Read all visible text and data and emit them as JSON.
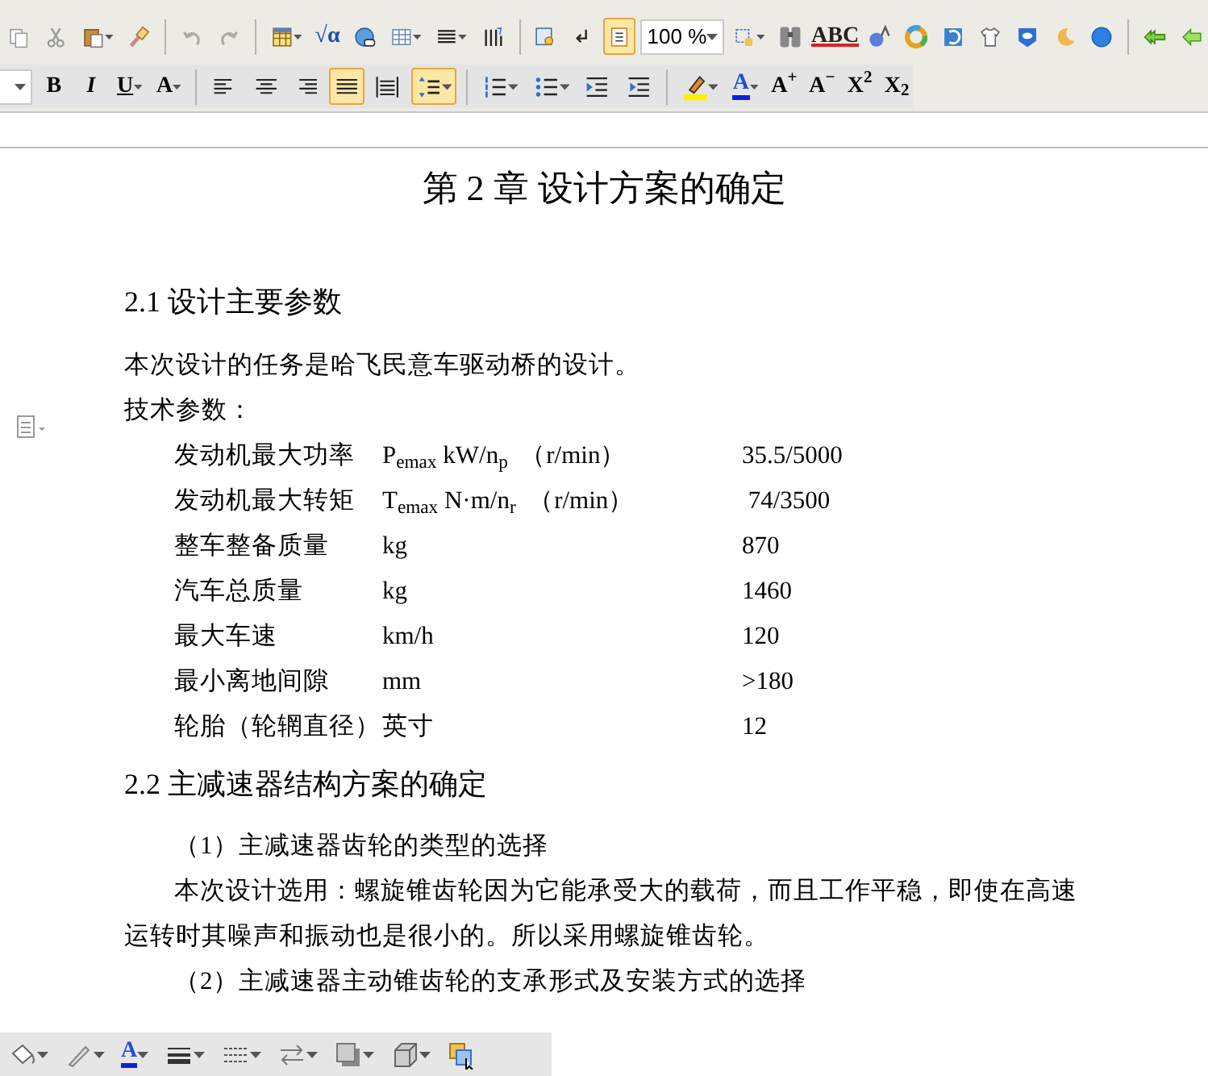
{
  "standard_toolbar": [
    {
      "kind": "button",
      "selected": false
    },
    {
      "kind": "button",
      "selected": false
    },
    {
      "kind": "button",
      "selected": false
    },
    {
      "kind": "button",
      "selected": false
    },
    {
      "kind": "button",
      "selected": false
    },
    {
      "kind": "button",
      "selected": false
    },
    {
      "kind": "button",
      "selected": false
    },
    {
      "kind": "button",
      "label": "√α",
      "selected": false
    },
    {
      "kind": "button",
      "selected": false
    },
    {
      "kind": "button",
      "selected": false
    },
    {
      "kind": "button",
      "selected": false
    },
    {
      "kind": "button",
      "selected": false
    },
    {
      "kind": "button",
      "selected": false
    },
    {
      "kind": "button",
      "selected": false
    },
    {
      "kind": "button",
      "selected": true
    },
    {
      "kind": "field",
      "value": "100 %"
    },
    {
      "kind": "button",
      "selected": false
    },
    {
      "kind": "button",
      "selected": false
    },
    {
      "kind": "button",
      "label": "ABC",
      "selected": false
    },
    {
      "kind": "button",
      "selected": false
    },
    {
      "kind": "button",
      "selected": false
    },
    {
      "kind": "button",
      "selected": false
    },
    {
      "kind": "button",
      "selected": false
    },
    {
      "kind": "button",
      "selected": false
    },
    {
      "kind": "button",
      "selected": false
    },
    {
      "kind": "button",
      "selected": false
    },
    {
      "kind": "button",
      "selected": false
    },
    {
      "kind": "button",
      "selected": false
    }
  ],
  "format_toolbar": [
    {
      "kind": "field"
    },
    {
      "kind": "button",
      "label": "B",
      "selected": false
    },
    {
      "kind": "button",
      "label": "I",
      "selected": false
    },
    {
      "kind": "button",
      "label": "U",
      "selected": false
    },
    {
      "kind": "button",
      "label": "A",
      "selected": false
    },
    {
      "kind": "button",
      "selected": false
    },
    {
      "kind": "button",
      "selected": false
    },
    {
      "kind": "button",
      "selected": false
    },
    {
      "kind": "button",
      "selected": true
    },
    {
      "kind": "button",
      "selected": false
    },
    {
      "kind": "button",
      "selected": true
    },
    {
      "kind": "button",
      "selected": false
    },
    {
      "kind": "button",
      "selected": false
    },
    {
      "kind": "button",
      "selected": false
    },
    {
      "kind": "button",
      "selected": false
    },
    {
      "kind": "button",
      "selected": false
    },
    {
      "kind": "button",
      "label": "A",
      "selected": false
    },
    {
      "kind": "button",
      "label": "A$^{+}$",
      "selected": false
    },
    {
      "kind": "button",
      "label": "A$^{−}$",
      "selected": false
    },
    {
      "kind": "button",
      "label": "X$^{2}$",
      "selected": false
    },
    {
      "kind": "button",
      "label": "X$_{2}$",
      "selected": false
    }
  ],
  "document": {
    "title": "第 2 章  设计方案的确定",
    "sections": [
      {
        "heading": "2.1  设计主要参数",
        "blocks": [
          {
            "kind": "paragraph",
            "text": "本次设计的任务是哈飞民意车驱动桥的设计。",
            "indent": false
          },
          {
            "kind": "paragraph",
            "text": "技术参数：",
            "indent": false
          },
          {
            "kind": "parameters",
            "rows": [
              {
                "name": "发动机最大功率",
                "unit": "P$_{emax}$ kW/n$_{p}$  （r/min）",
                "value": "35.5/5000"
              },
              {
                "name": "发动机最大转矩",
                "unit": "T$_{emax}$ N·m/n$_{r}$  （r/min）",
                "value": " 74/3500"
              },
              {
                "name": "整车整备质量",
                "unit": "kg",
                "value": "870"
              },
              {
                "name": "汽车总质量",
                "unit": "kg",
                "value": "1460"
              },
              {
                "name": "最大车速",
                "unit": "km/h",
                "value": "120"
              },
              {
                "name": "最小离地间隙",
                "unit": "mm",
                "value": ">180"
              },
              {
                "name": "轮胎（轮辋直径）",
                "unit": "英寸",
                "value": "12"
              }
            ]
          }
        ]
      },
      {
        "heading": "2.2 主减速器结构方案的确定",
        "blocks": [
          {
            "kind": "paragraph",
            "text": "（1）主减速器齿轮的类型的选择",
            "indent": true
          },
          {
            "kind": "paragraph",
            "text": "本次设计选用：螺旋锥齿轮因为它能承受大的载荷，而且工作平稳，即使在高速运转时其噪声和振动也是很小的。所以采用螺旋锥齿轮。",
            "indent": true
          },
          {
            "kind": "paragraph",
            "text": "（2）主减速器主动锥齿轮的支承形式及安装方式的选择",
            "indent": true
          }
        ]
      }
    ]
  },
  "drawing_toolbar": [
    {
      "kind": "button",
      "selected": false
    },
    {
      "kind": "button",
      "selected": false
    },
    {
      "kind": "button",
      "label": "A",
      "selected": false
    },
    {
      "kind": "button",
      "selected": false
    },
    {
      "kind": "button",
      "selected": false
    },
    {
      "kind": "button",
      "selected": false
    },
    {
      "kind": "button",
      "selected": false
    },
    {
      "kind": "button",
      "selected": false
    },
    {
      "kind": "button",
      "selected": false
    }
  ]
}
